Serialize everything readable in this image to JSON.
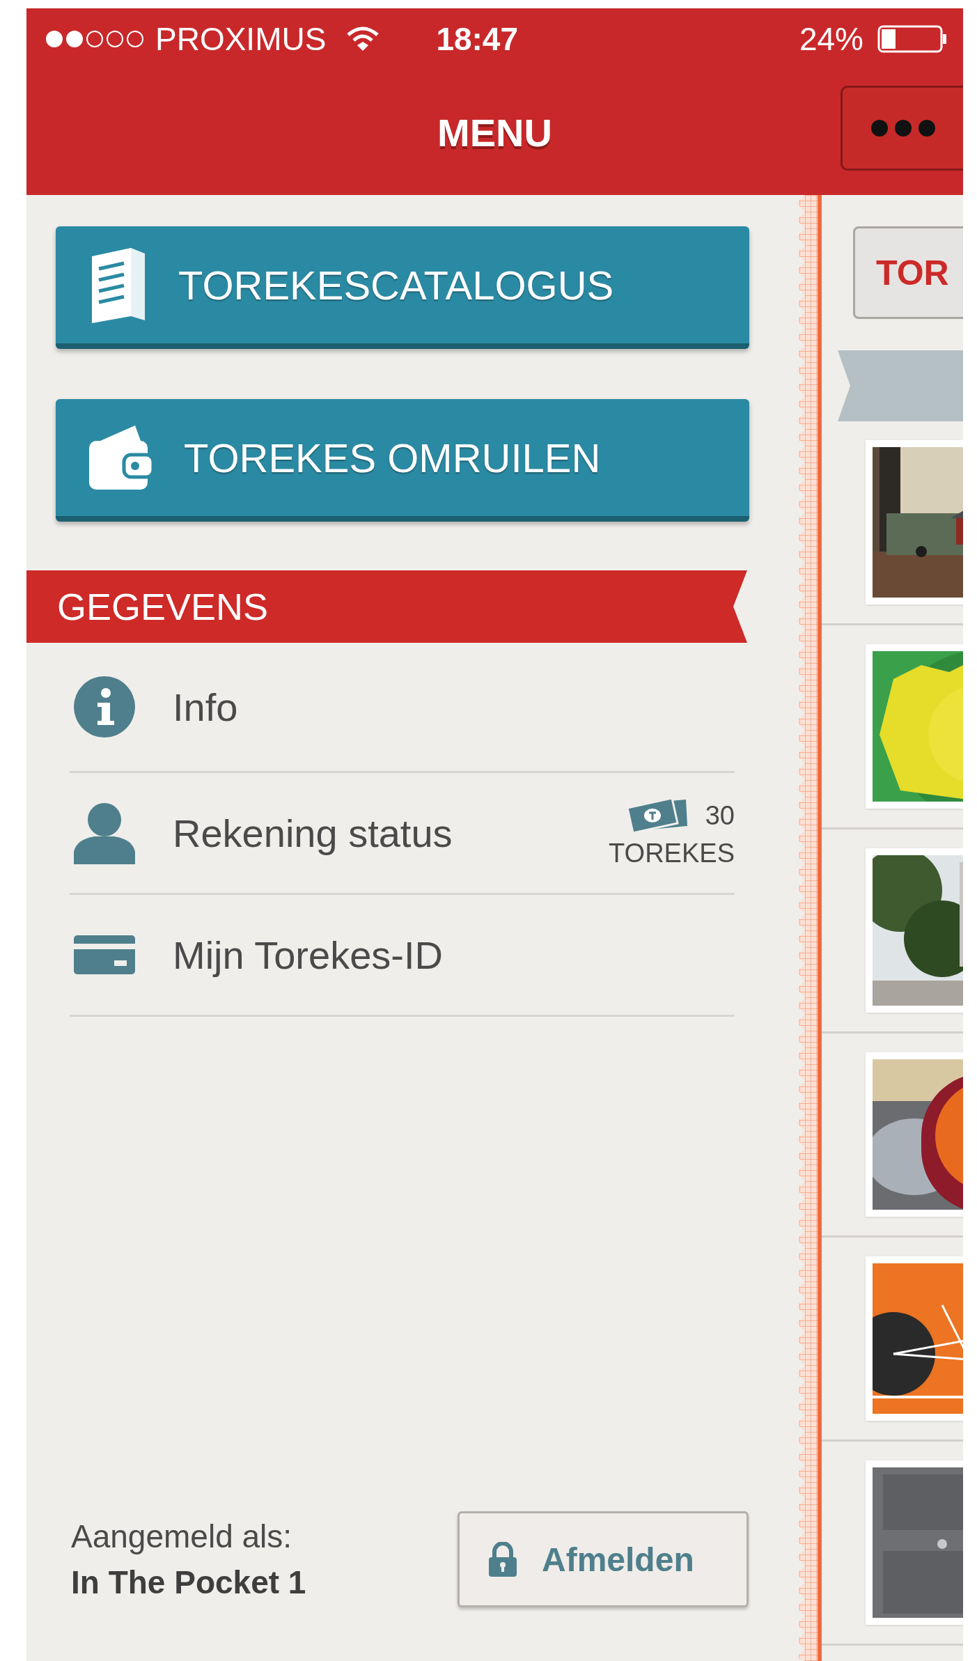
{
  "status_bar": {
    "carrier": "PROXIMUS",
    "time": "18:47",
    "battery": "24%"
  },
  "header": {
    "title": "MENU"
  },
  "menu_buttons": [
    {
      "kind": "catalogue",
      "label": "TOREKESCATALOGUS"
    },
    {
      "kind": "exchange",
      "label": "TOREKES OMRUILEN"
    }
  ],
  "section": {
    "title": "GEGEVENS"
  },
  "items": [
    {
      "kind": "info",
      "label": "Info"
    },
    {
      "kind": "account",
      "label": "Rekening status",
      "balance": {
        "amount": "30",
        "unit": "TOREKES"
      }
    },
    {
      "kind": "id",
      "label": "Mijn Torekes-ID"
    }
  ],
  "footer": {
    "label": "Aangemeld als:",
    "user": "In The Pocket 1",
    "logout_button": "Afmelden"
  },
  "side_panel": {
    "button": "TOR"
  }
}
